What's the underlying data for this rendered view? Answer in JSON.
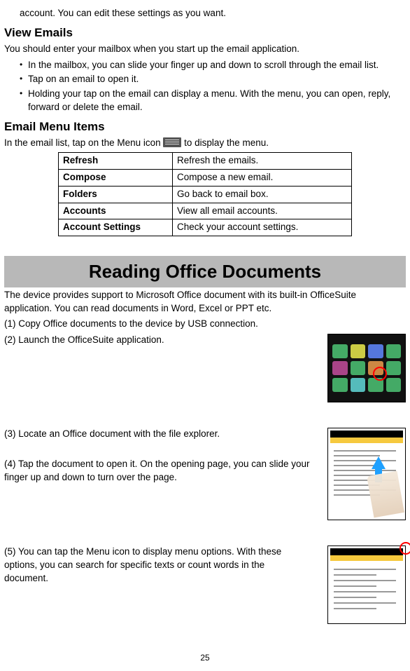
{
  "intro_partial": "account. You can edit these settings as you want.",
  "view_emails": {
    "heading": "View Emails",
    "intro": "You should enter your mailbox when you start up the email application.",
    "bullets": [
      "In the mailbox, you can slide your finger up and down to scroll through the email list.",
      "Tap on an email to open it.",
      "Holding your tap on the email can display a menu. With the menu, you can open, reply, forward or delete the email."
    ]
  },
  "menu_items": {
    "heading": "Email Menu Items",
    "intro_before": "In the email list, tap on the Menu icon ",
    "intro_after": " to display the menu.",
    "rows": [
      {
        "k": "Refresh",
        "v": "Refresh the emails."
      },
      {
        "k": "Compose",
        "v": "Compose a new email."
      },
      {
        "k": "Folders",
        "v": "Go back to email box."
      },
      {
        "k": "Accounts",
        "v": "View all email accounts."
      },
      {
        "k": "Account Settings",
        "v": "Check your account settings."
      }
    ]
  },
  "reading": {
    "banner": "Reading Office Documents",
    "intro": "The device provides support to Microsoft Office document with its built-in OfficeSuite application. You can read documents in Word, Excel or PPT etc.",
    "steps": [
      "(1)    Copy Office documents to the device by USB connection.",
      "(2)    Launch the OfficeSuite application.",
      "(3)    Locate an Office document with the file explorer.",
      "(4)    Tap the document to open it. On the opening page, you can slide your finger up and down to turn over the page.",
      "(5)    You can tap the Menu icon to display menu options. With these options, you can search for specific texts or count words in the document."
    ]
  },
  "page_number": "25"
}
